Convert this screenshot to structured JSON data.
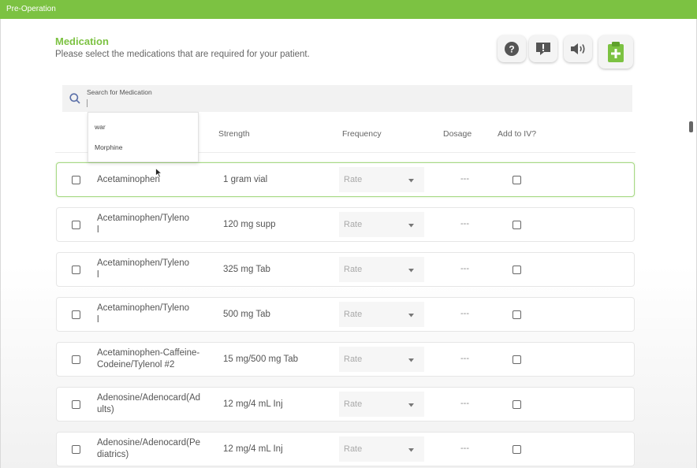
{
  "topbar": {
    "title": "Pre-Operation"
  },
  "header": {
    "title": "Medication",
    "subtitle": "Please select the medications that are required for your patient."
  },
  "toolbar": {
    "buttons": [
      {
        "icon": "help-icon"
      },
      {
        "icon": "feedback-icon"
      },
      {
        "icon": "speaker-icon"
      },
      {
        "icon": "add-clipboard-icon"
      }
    ]
  },
  "search": {
    "placeholder": "Search for Medication",
    "suggestions": [
      "war",
      "Morphine"
    ]
  },
  "table": {
    "columns": [
      "Strength",
      "Frequency",
      "Dosage",
      "Add to IV?"
    ],
    "frequency_placeholder": "Rate",
    "dosage_placeholder": "---",
    "rows": [
      {
        "name": "Acetaminophen",
        "strength": "1 gram vial",
        "selected": true
      },
      {
        "name": "Acetaminophen/Tyleno\nl",
        "strength": "120 mg supp"
      },
      {
        "name": "Acetaminophen/Tyleno\nl",
        "strength": "325 mg Tab"
      },
      {
        "name": "Acetaminophen/Tyleno\nl",
        "strength": "500 mg Tab"
      },
      {
        "name": "Acetaminophen-Caffeine-\nCodeine/Tylenol #2",
        "strength": "15 mg/500 mg Tab"
      },
      {
        "name": "Adenosine/Adenocard(Ad\nults)",
        "strength": "12 mg/4 mL Inj"
      },
      {
        "name": "Adenosine/Adenocard(Pe\ndiatrics)",
        "strength": "12 mg/4 mL Inj"
      }
    ]
  },
  "colors": {
    "accent": "#7cc242",
    "accent_light": "#a7d985",
    "help_icon": "#555555",
    "add_icon": "#7cc242"
  }
}
